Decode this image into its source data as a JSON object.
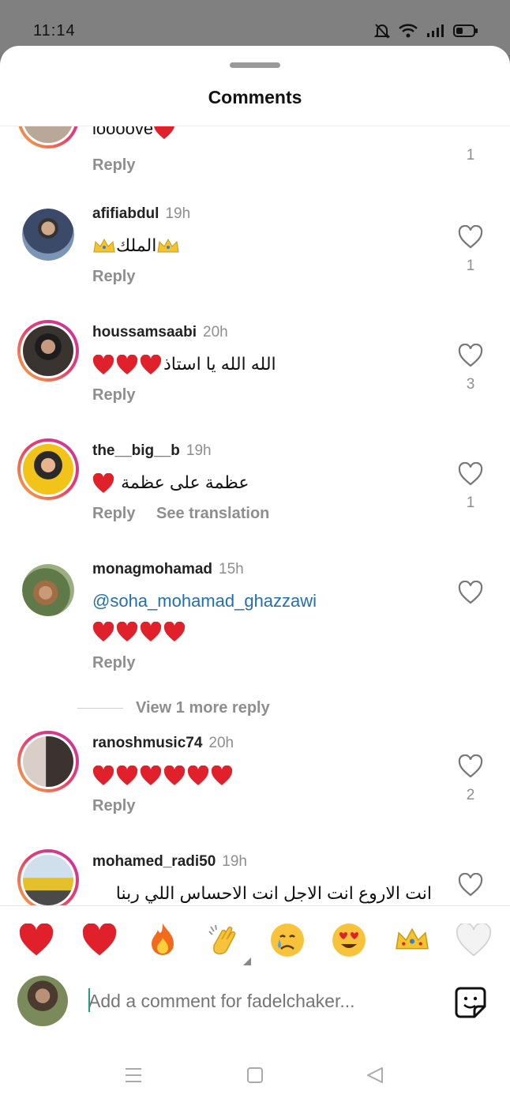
{
  "status": {
    "time": "11:14"
  },
  "sheet": {
    "title": "Comments"
  },
  "comments": [
    {
      "username": "",
      "time": "",
      "text": "loooove",
      "reply": "Reply",
      "likes": "1"
    },
    {
      "username": "afifiabdul",
      "time": "19h",
      "text": "الملك",
      "reply": "Reply",
      "likes": "1"
    },
    {
      "username": "houssamsaabi",
      "time": "20h",
      "text": "الله الله يا استاذ",
      "reply": "Reply",
      "likes": "3"
    },
    {
      "username": "the__big__b",
      "time": "19h",
      "text": "عظمة على عظمة",
      "reply": "Reply",
      "see_translation": "See translation",
      "likes": "1"
    },
    {
      "username": "monagmohamad",
      "time": "15h",
      "mention": "@soha_mohamad_ghazzawi",
      "reply": "Reply",
      "likes": ""
    },
    {
      "username": "ranoshmusic74",
      "time": "20h",
      "reply": "Reply",
      "likes": "2"
    },
    {
      "username": "mohamed_radi50",
      "time": "19h",
      "text": "انت الاروع انت الاجل انت الاحساس اللي ربنا",
      "likes": ""
    }
  ],
  "view_more_reply": "View 1 more reply",
  "quick_emojis": [
    "red-heart",
    "red-heart",
    "fire",
    "clapping-hands",
    "crying-face",
    "heart-eyes-face",
    "crown",
    "white-heart"
  ],
  "composer": {
    "placeholder": "Add a comment for fadelchaker..."
  },
  "colors": {
    "accent": "#1f6fb5",
    "heart": "#e0202a",
    "muted": "#8e8e8e"
  }
}
